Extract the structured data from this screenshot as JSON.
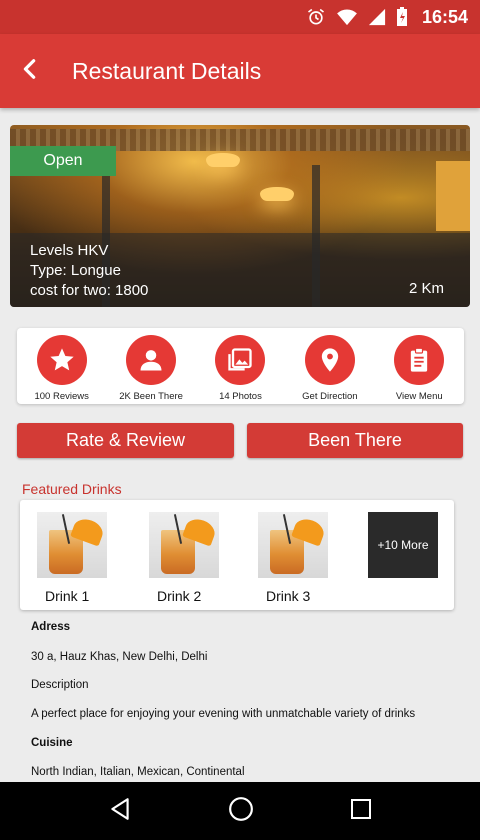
{
  "status_bar": {
    "time": "16:54"
  },
  "app_bar": {
    "title": "Restaurant Details"
  },
  "restaurant": {
    "status": "Open",
    "name": "Levels HKV",
    "type": "Type: Longue",
    "cost": "cost for two: 1800",
    "distance": "2 Km"
  },
  "actions": [
    {
      "label": "100 Reviews",
      "icon": "star-icon"
    },
    {
      "label": "2K Been There",
      "icon": "person-icon"
    },
    {
      "label": "14 Photos",
      "icon": "photo-icon"
    },
    {
      "label": "Get Direction",
      "icon": "location-pin-icon"
    },
    {
      "label": "View Menu",
      "icon": "clipboard-icon"
    }
  ],
  "buttons": {
    "rate_review": "Rate & Review",
    "been_there": "Been There"
  },
  "featured": {
    "title": "Featured Drinks",
    "drinks": [
      "Drink 1",
      "Drink 2",
      "Drink 3"
    ],
    "more": "+10 More"
  },
  "details": {
    "address_label": "Adress",
    "address": "30 a, Hauz Khas, New Delhi, Delhi",
    "description_label": "Description",
    "description": "A perfect place for enjoying your evening with unmatchable variety of drinks",
    "cuisine_label": "Cuisine",
    "cuisine": "North Indian, Italian, Mexican, Continental"
  },
  "colors": {
    "primary": "#d93b36",
    "status_bar": "#c8332e",
    "open_badge": "#3d9a4f",
    "icon_circle": "#e53935"
  }
}
